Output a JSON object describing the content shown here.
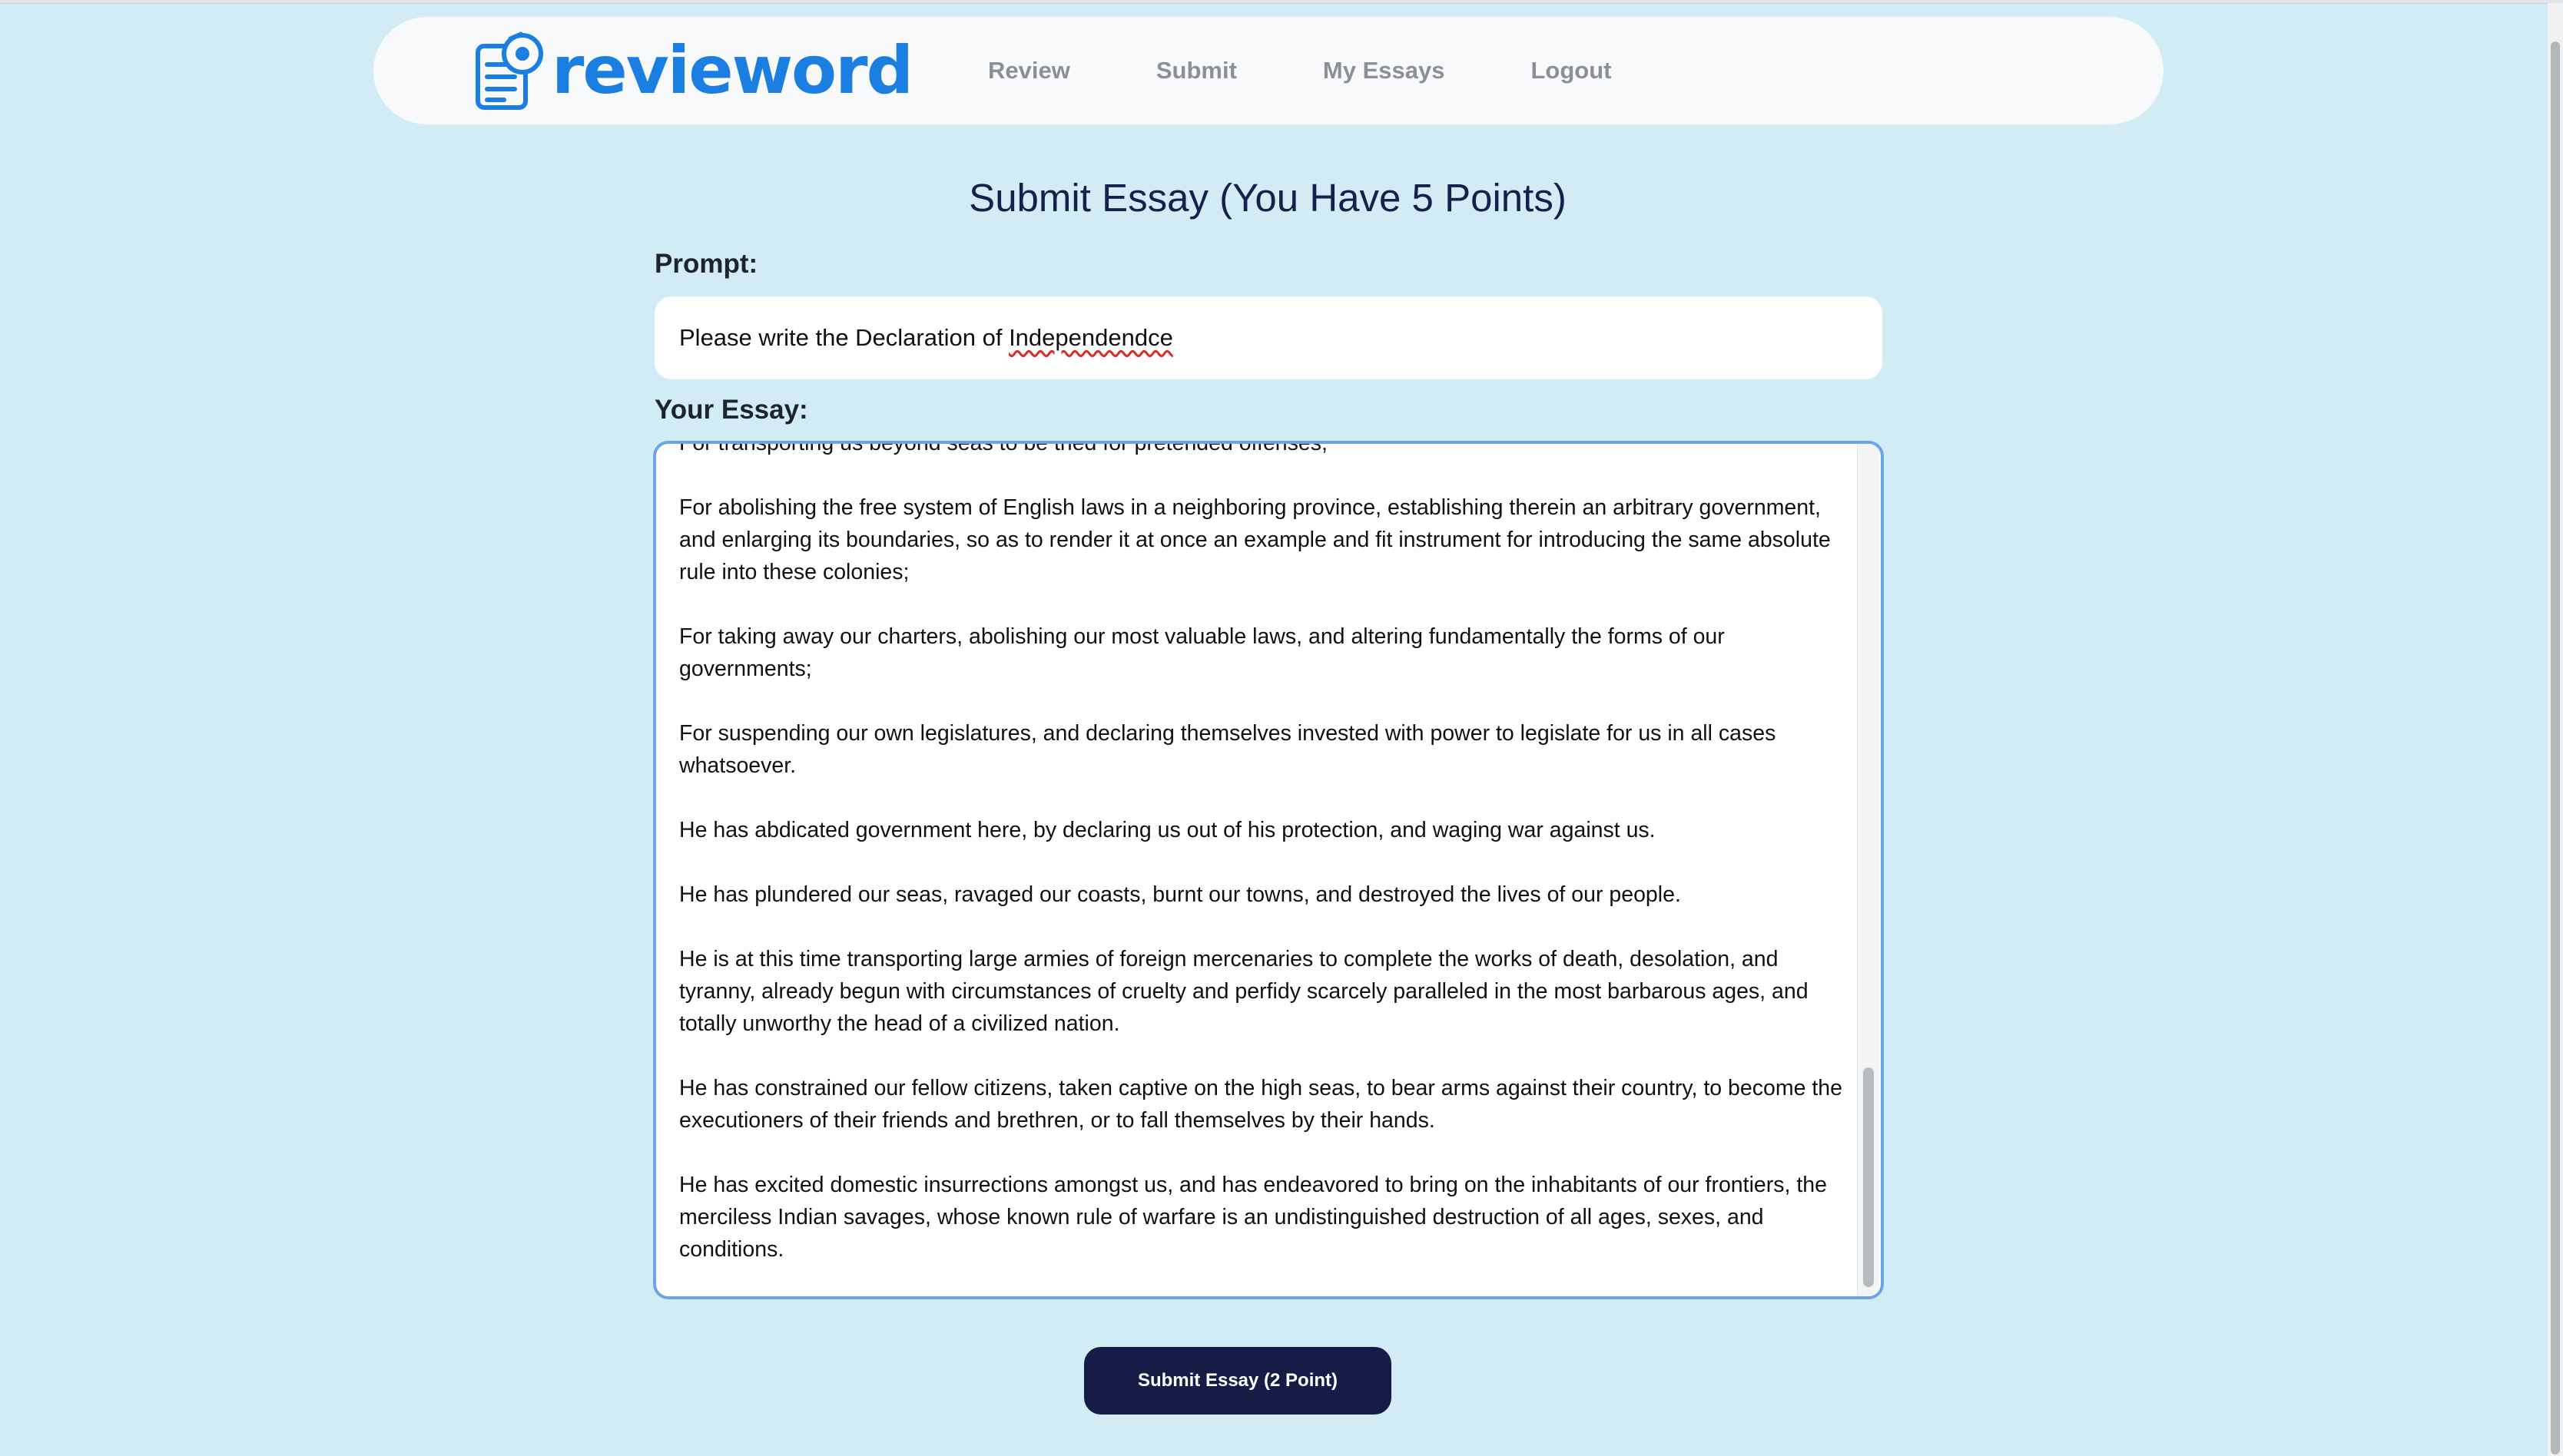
{
  "brand": {
    "logo_text": "revieword",
    "logo_icon": "document-eye-icon",
    "accent_color": "#1a7fe0"
  },
  "nav": {
    "items": [
      {
        "label": "Review"
      },
      {
        "label": "Submit"
      },
      {
        "label": "My Essays"
      },
      {
        "label": "Logout"
      }
    ]
  },
  "page": {
    "title": "Submit Essay (You Have 5 Points)"
  },
  "prompt": {
    "label": "Prompt:",
    "text_before": "Please write the Declaration of ",
    "misspelled_word": "Independendce"
  },
  "essay": {
    "label": "Your Essay:",
    "paragraphs": [
      "For transporting us beyond seas to be tried for pretended offenses;",
      "For abolishing the free system of English laws in a neighboring province, establishing therein an arbitrary government, and enlarging its boundaries, so as to render it at once an example and fit instrument for introducing the same absolute rule into these colonies;",
      "For taking away our charters, abolishing our most valuable laws, and altering fundamentally the forms of our governments;",
      "For suspending our own legislatures, and declaring themselves invested with power to legislate for us in all cases whatsoever.",
      "He has abdicated government here, by declaring us out of his protection, and waging war against us.",
      "He has plundered our seas, ravaged our coasts, burnt our towns, and destroyed the lives of our people.",
      "He is at this time transporting large armies of foreign mercenaries to complete the works of death, desolation, and tyranny, already begun with circumstances of cruelty and perfidy scarcely paralleled in the most barbarous ages, and totally unworthy the head of a civilized nation.",
      "He has constrained our fellow citizens, taken captive on the high seas, to bear arms against their country, to become the executioners of their friends and brethren, or to fall themselves by their hands.",
      "He has excited domestic insurrections amongst us, and has endeavored to bring on the inhabitants of our frontiers, the merciless Indian savages, whose known rule of warfare is an undistinguished destruction of all ages, sexes, and conditions."
    ]
  },
  "submit": {
    "label": "Submit Essay (2 Point)",
    "color": "#151d47"
  }
}
